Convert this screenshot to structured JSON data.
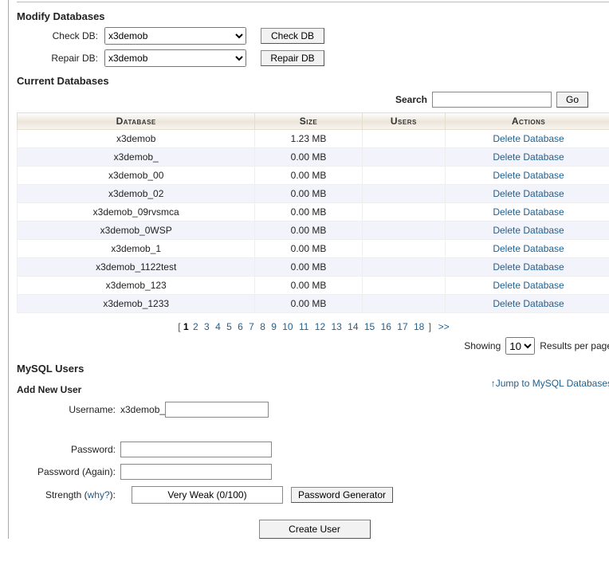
{
  "modify": {
    "heading": "Modify Databases",
    "check_label": "Check DB:",
    "repair_label": "Repair DB:",
    "selected": "x3demob",
    "check_btn": "Check DB",
    "repair_btn": "Repair DB"
  },
  "current": {
    "heading": "Current Databases",
    "search_label": "Search",
    "go_btn": "Go",
    "cols": {
      "db": "Database",
      "size": "Size",
      "users": "Users",
      "actions": "Actions"
    },
    "delete_label": "Delete Database",
    "rows": [
      {
        "db": "x3demob",
        "size": "1.23 MB"
      },
      {
        "db": "x3demob_",
        "size": "0.00 MB"
      },
      {
        "db": "x3demob_00",
        "size": "0.00 MB"
      },
      {
        "db": "x3demob_02",
        "size": "0.00 MB"
      },
      {
        "db": "x3demob_09rvsmca",
        "size": "0.00 MB"
      },
      {
        "db": "x3demob_0WSP",
        "size": "0.00 MB"
      },
      {
        "db": "x3demob_1",
        "size": "0.00 MB"
      },
      {
        "db": "x3demob_1122test",
        "size": "0.00 MB"
      },
      {
        "db": "x3demob_123",
        "size": "0.00 MB"
      },
      {
        "db": "x3demob_1233",
        "size": "0.00 MB"
      }
    ],
    "pages": 18,
    "current_page": 1,
    "next_label": ">>"
  },
  "results": {
    "showing_label": "Showing",
    "per_page": "10",
    "rpp_label": "Results per page",
    "jump_label": "Jump to MySQL Databases",
    "arrow": "↑"
  },
  "users": {
    "heading": "MySQL Users",
    "add_heading": "Add New User",
    "username_label": "Username:",
    "prefix": "x3demob_",
    "password_label": "Password:",
    "password2_label": "Password (Again):",
    "strength_label_pre": "Strength (",
    "why_text": "why?",
    "strength_label_post": "):",
    "strength_value": "Very Weak (0/100)",
    "pw_gen_btn": "Password Generator",
    "create_btn": "Create User"
  }
}
